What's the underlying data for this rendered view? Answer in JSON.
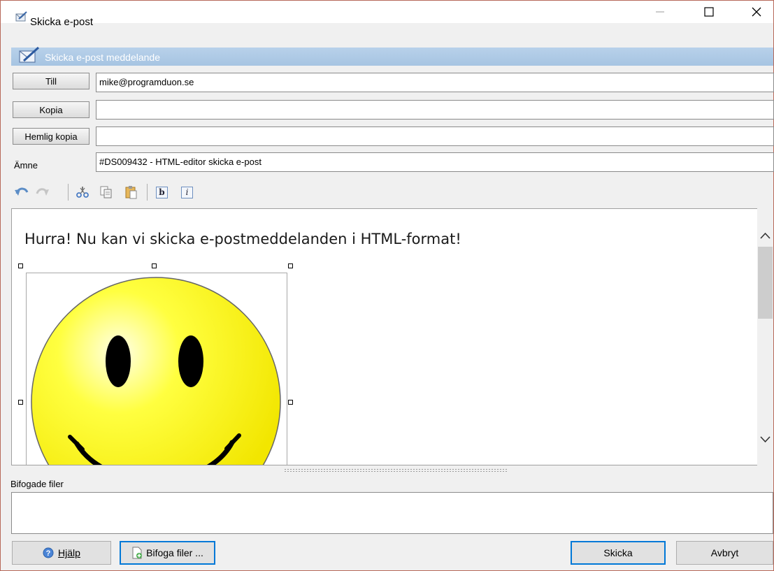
{
  "window": {
    "title": "Skicka e-post",
    "minimize": "—",
    "maximize": "☐",
    "close": "✕"
  },
  "banner": {
    "title": "Skicka e-post meddelande"
  },
  "fields": {
    "to_button": "Till",
    "to_value": "mike@programduon.se",
    "cc_button": "Kopia",
    "cc_value": "",
    "bcc_button": "Hemlig kopia",
    "bcc_value": "",
    "subject_label": "Ämne",
    "subject_value": "#DS009432 - HTML-editor skicka e-post"
  },
  "toolbar": {
    "items": [
      "undo-icon",
      "redo-icon",
      "cut-icon",
      "copy-icon",
      "paste-icon",
      "bold-icon",
      "italic-icon"
    ],
    "bold_glyph": "b",
    "italic_glyph": "i"
  },
  "editor": {
    "body_text": "Hurra! Nu kan vi skicka e-postmeddelanden i HTML-format!",
    "image": "smiley-face"
  },
  "attachments": {
    "label": "Bifogade filer"
  },
  "buttons": {
    "help": "Hjälp",
    "attach": "Bifoga filer ...",
    "send": "Skicka",
    "cancel": "Avbryt"
  },
  "colors": {
    "banner": "#a6c4e2",
    "focus": "#0078d7",
    "smiley": "#ffff00"
  }
}
